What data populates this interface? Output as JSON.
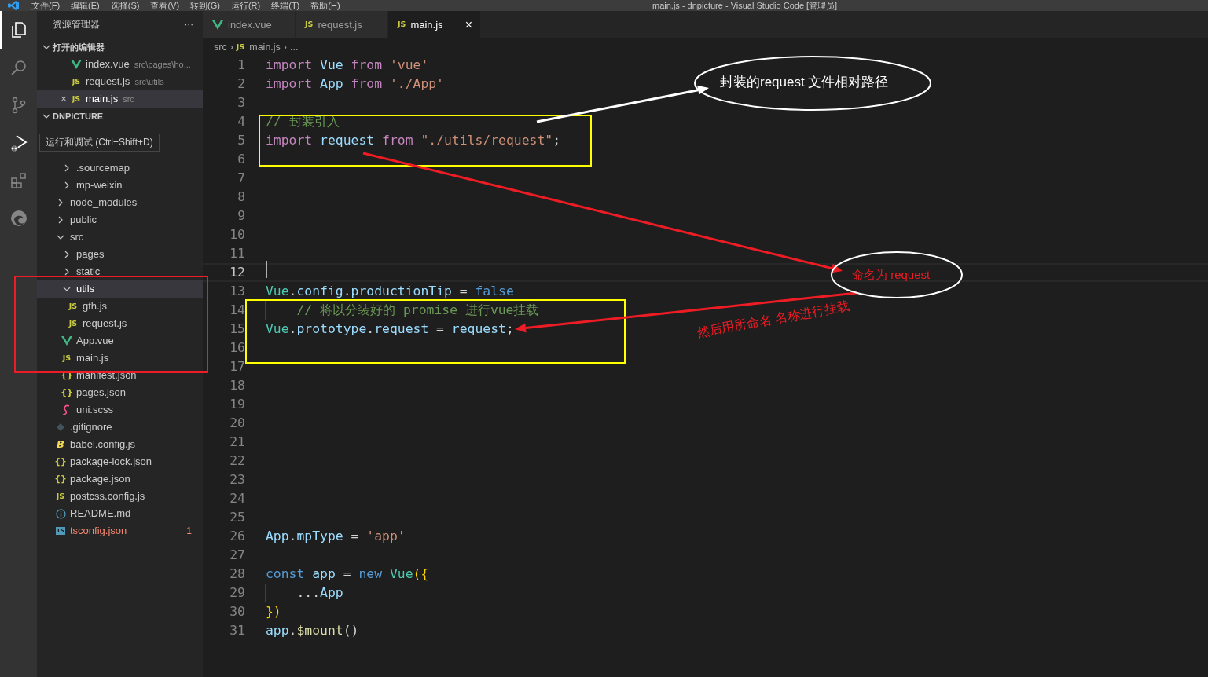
{
  "menu_bar": {
    "items": [
      "文件(F)",
      "编辑(E)",
      "选择(S)",
      "查看(V)",
      "转到(G)",
      "运行(R)",
      "终端(T)",
      "帮助(H)"
    ],
    "title": "main.js - dnpicture - Visual Studio Code [管理员]"
  },
  "activity_bar": [
    {
      "kind": "files",
      "selected": true,
      "hovered": false
    },
    {
      "kind": "search",
      "selected": false,
      "hovered": false
    },
    {
      "kind": "source-control",
      "selected": false,
      "hovered": false
    },
    {
      "kind": "debug",
      "selected": false,
      "hovered": true
    },
    {
      "kind": "extensions",
      "selected": false,
      "hovered": false
    },
    {
      "kind": "edge",
      "selected": false,
      "hovered": false
    }
  ],
  "tooltip": "运行和调试 (Ctrl+Shift+D)",
  "sidebar": {
    "title": "资源管理器",
    "more": "···",
    "open_editors": {
      "title": "打开的编辑器",
      "expanded": true,
      "items": [
        {
          "label": "index.vue",
          "path": "src\\pages\\ho...",
          "kind": "vue",
          "selected": false
        },
        {
          "label": "request.js",
          "path": "src\\utils",
          "kind": "js",
          "icon": "JS",
          "selected": false
        },
        {
          "label": "main.js",
          "path": "src",
          "kind": "js",
          "icon": "JS",
          "selected": true,
          "close": "×"
        }
      ]
    },
    "workspace": {
      "title": "DNPICTURE",
      "expanded": true,
      "tree": [
        {
          "kind": "covered",
          "selected": false,
          "children": [
            {
              "kind": "covered",
              "selected": false
            },
            {
              "label": ".sourcemap",
              "kind": "folder",
              "expanded": false,
              "selected": false
            },
            {
              "label": "mp-weixin",
              "kind": "folder",
              "expanded": false,
              "selected": false
            }
          ]
        },
        {
          "label": "node_modules",
          "kind": "folder",
          "expanded": false,
          "selected": false
        },
        {
          "label": "public",
          "kind": "folder",
          "expanded": false,
          "selected": false
        },
        {
          "label": "src",
          "kind": "folder",
          "expanded": true,
          "selected": false,
          "children": [
            {
              "label": "pages",
              "kind": "folder",
              "expanded": false,
              "selected": false
            },
            {
              "label": "static",
              "kind": "folder",
              "expanded": false,
              "selected": false
            },
            {
              "label": "utils",
              "kind": "folder",
              "expanded": true,
              "selected": true,
              "children": [
                {
                  "label": "gth.js",
                  "kind": "js",
                  "icon": "JS",
                  "selected": false
                },
                {
                  "label": "request.js",
                  "kind": "js",
                  "icon": "JS",
                  "selected": false
                }
              ]
            },
            {
              "label": "App.vue",
              "kind": "vue",
              "selected": false
            },
            {
              "label": "main.js",
              "kind": "js",
              "icon": "JS",
              "selected": false
            },
            {
              "label": "manifest.json",
              "kind": "json",
              "icon": "{}",
              "selected": false
            },
            {
              "label": "pages.json",
              "kind": "json",
              "icon": "{}",
              "selected": false
            },
            {
              "label": "uni.scss",
              "kind": "scss",
              "selected": false
            }
          ]
        },
        {
          "label": ".gitignore",
          "kind": "git",
          "selected": false
        },
        {
          "label": "babel.config.js",
          "kind": "babel",
          "icon": "B",
          "selected": false
        },
        {
          "label": "package-lock.json",
          "kind": "json",
          "icon": "{}",
          "selected": false
        },
        {
          "label": "package.json",
          "kind": "json",
          "icon": "{}",
          "selected": false
        },
        {
          "label": "postcss.config.js",
          "kind": "js",
          "icon": "JS",
          "selected": false
        },
        {
          "label": "README.md",
          "kind": "info",
          "selected": false
        },
        {
          "label": "tsconfig.json",
          "kind": "ts",
          "icon": "TS",
          "selected": false,
          "error": true,
          "problems": "1"
        }
      ]
    }
  },
  "tabs": [
    {
      "label": "index.vue",
      "kind": "vue",
      "selected": false
    },
    {
      "label": "request.js",
      "kind": "js",
      "icon": "JS",
      "selected": false
    },
    {
      "label": "main.js",
      "kind": "js",
      "icon": "JS",
      "selected": true,
      "close": "×"
    }
  ],
  "breadcrumb": [
    {
      "label": "src",
      "sep": "›"
    },
    {
      "label": "main.js",
      "icon": "JS",
      "sep": "›"
    },
    {
      "label": "..."
    }
  ],
  "editor": {
    "lines": [
      {
        "number": "1",
        "current": false,
        "tokens": [
          {
            "kind": "keyword",
            "text": "import "
          },
          {
            "kind": "variable",
            "text": "Vue "
          },
          {
            "kind": "keyword",
            "text": "from "
          },
          {
            "kind": "string",
            "text": "'vue'"
          }
        ]
      },
      {
        "number": "2",
        "current": false,
        "tokens": [
          {
            "kind": "keyword",
            "text": "import "
          },
          {
            "kind": "variable",
            "text": "App "
          },
          {
            "kind": "keyword",
            "text": "from "
          },
          {
            "kind": "string",
            "text": "'./App'"
          }
        ]
      },
      {
        "number": "3",
        "current": false
      },
      {
        "number": "4",
        "current": false,
        "tokens": [
          {
            "kind": "comment",
            "text": "// 封装引入"
          }
        ]
      },
      {
        "number": "5",
        "current": false,
        "tokens": [
          {
            "kind": "keyword",
            "text": "import "
          },
          {
            "kind": "variable",
            "text": "request "
          },
          {
            "kind": "keyword",
            "text": "from "
          },
          {
            "kind": "string",
            "text": "\"./utils/request\""
          },
          {
            "kind": "plain",
            "text": ";"
          }
        ]
      },
      {
        "number": "6",
        "current": false
      },
      {
        "number": "7",
        "current": false
      },
      {
        "number": "8",
        "current": false
      },
      {
        "number": "9",
        "current": false
      },
      {
        "number": "10",
        "current": false
      },
      {
        "number": "11",
        "current": false
      },
      {
        "number": "12",
        "current": true
      },
      {
        "number": "13",
        "current": false,
        "tokens": [
          {
            "kind": "class",
            "text": "Vue"
          },
          {
            "kind": "plain",
            "text": "."
          },
          {
            "kind": "variable",
            "text": "config"
          },
          {
            "kind": "plain",
            "text": "."
          },
          {
            "kind": "variable",
            "text": "productionTip"
          },
          {
            "kind": "plain",
            "text": " = "
          },
          {
            "kind": "constant",
            "text": "false"
          }
        ]
      },
      {
        "number": "14",
        "current": false,
        "guide": true,
        "tokens": [
          {
            "kind": "comment",
            "text": "    // 将以分装好的 promise 进行vue挂载"
          }
        ]
      },
      {
        "number": "15",
        "current": false,
        "tokens": [
          {
            "kind": "class",
            "text": "Vue"
          },
          {
            "kind": "plain",
            "text": "."
          },
          {
            "kind": "variable",
            "text": "prototype"
          },
          {
            "kind": "plain",
            "text": "."
          },
          {
            "kind": "variable",
            "text": "request"
          },
          {
            "kind": "plain",
            "text": " = "
          },
          {
            "kind": "variable",
            "text": "request"
          },
          {
            "kind": "plain",
            "text": ";"
          }
        ]
      },
      {
        "number": "16",
        "current": false
      },
      {
        "number": "17",
        "current": false
      },
      {
        "number": "18",
        "current": false
      },
      {
        "number": "19",
        "current": false
      },
      {
        "number": "20",
        "current": false
      },
      {
        "number": "21",
        "current": false
      },
      {
        "number": "22",
        "current": false
      },
      {
        "number": "23",
        "current": false
      },
      {
        "number": "24",
        "current": false
      },
      {
        "number": "25",
        "current": false
      },
      {
        "number": "26",
        "current": false,
        "tokens": [
          {
            "kind": "variable",
            "text": "App"
          },
          {
            "kind": "plain",
            "text": "."
          },
          {
            "kind": "variable",
            "text": "mpType"
          },
          {
            "kind": "plain",
            "text": " = "
          },
          {
            "kind": "string",
            "text": "'app'"
          }
        ]
      },
      {
        "number": "27",
        "current": false
      },
      {
        "number": "28",
        "current": false,
        "tokens": [
          {
            "kind": "constant",
            "text": "const "
          },
          {
            "kind": "variable",
            "text": "app"
          },
          {
            "kind": "plain",
            "text": " = "
          },
          {
            "kind": "constant",
            "text": "new "
          },
          {
            "kind": "class",
            "text": "Vue"
          },
          {
            "kind": "brace",
            "text": "({"
          }
        ]
      },
      {
        "number": "29",
        "current": false,
        "guide": true,
        "tokens": [
          {
            "kind": "plain",
            "text": "    ..."
          },
          {
            "kind": "variable",
            "text": "App"
          }
        ]
      },
      {
        "number": "30",
        "current": false,
        "tokens": [
          {
            "kind": "brace",
            "text": "})"
          }
        ]
      },
      {
        "number": "31",
        "current": false,
        "tokens": [
          {
            "kind": "variable",
            "text": "app"
          },
          {
            "kind": "plain",
            "text": "."
          },
          {
            "kind": "function",
            "text": "$mount"
          },
          {
            "kind": "plain",
            "text": "()"
          }
        ]
      }
    ]
  },
  "annotations": [
    {
      "kind": "box",
      "color": "#ffff00"
    },
    {
      "kind": "box",
      "color": "#ffff00"
    },
    {
      "kind": "box",
      "color": "#ee1c24"
    },
    {
      "kind": "arrow",
      "color": "#ffffff"
    },
    {
      "kind": "arrow",
      "color": "#ee1c24"
    },
    {
      "kind": "arrow",
      "color": "#ee1c24"
    },
    {
      "kind": "ellipse",
      "text": "封装的request 文件相对路径",
      "color": "#ffffff"
    },
    {
      "kind": "ellipse",
      "text": "命名为 request",
      "color": "#ee1c24"
    },
    {
      "kind": "label",
      "text": "然后用所命名 名称进行挂载",
      "color": "#ee1c24"
    }
  ]
}
